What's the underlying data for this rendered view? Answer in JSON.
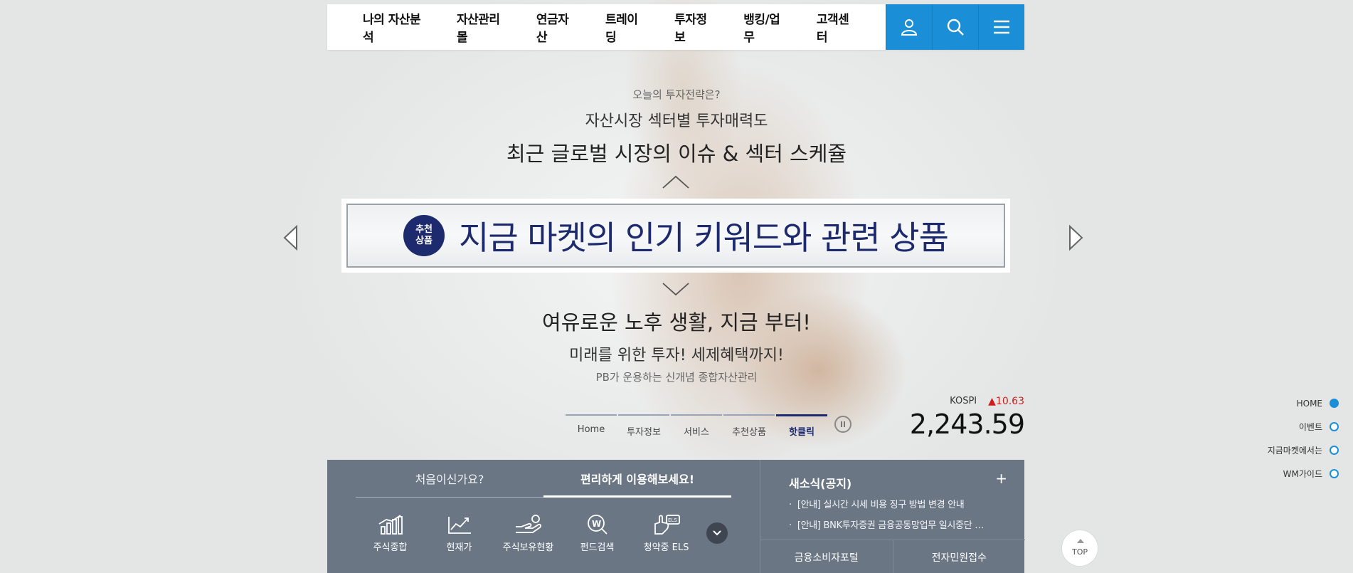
{
  "nav": {
    "items": [
      "나의 자산분석",
      "자산관리몰",
      "연금자산",
      "트레이딩",
      "투자정보",
      "뱅킹/업무",
      "고객센터"
    ],
    "icons": [
      "user-icon",
      "search-icon",
      "menu-icon"
    ],
    "accent": "#1a8fd8"
  },
  "hero": {
    "top_small": "오늘의 투자전략은?",
    "top_mid": "자산시장 섹터별 투자매력도",
    "top_big": "최근 글로벌 시장의 이슈 & 섹터 스케쥴",
    "feature_badge": "추천\n상품",
    "feature_title": "지금 마켓의 인기 키워드와 관련 상품",
    "bottom_big": "여유로운 노후 생활, 지금 부터!",
    "bottom_mid": "미래를 위한 투자! 세제혜택까지!",
    "bottom_small": "PB가 운용하는 신개념 종합자산관리"
  },
  "slide_tabs": [
    "Home",
    "투자정보",
    "서비스",
    "추천상품",
    "핫클릭"
  ],
  "kospi": {
    "label": "KOSPI",
    "change": "▲10.63",
    "value": "2,243.59"
  },
  "bottom": {
    "tabs": [
      "처음이신가요?",
      "편리하게 이용해보세요!"
    ],
    "quick": [
      "주식종합",
      "현재가",
      "주식보유현황",
      "펀드검색",
      "청약중 ELS"
    ],
    "news_title": "새소식(공지)",
    "news_plus": "+",
    "news": [
      "[안내] 실시간 시세 비용 징구 방법 변경 안내",
      "[안내] BNK투자증권 금융공동망업무 일시중단 …"
    ],
    "links": [
      "금융소비자포털",
      "전자민원접수"
    ]
  },
  "sidenav": [
    "HOME",
    "이벤트",
    "지금마켓에서는",
    "WM가이드"
  ],
  "top_btn": "TOP"
}
